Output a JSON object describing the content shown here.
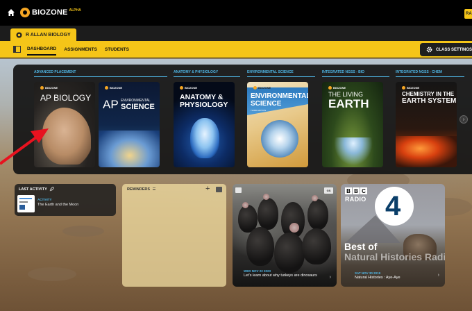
{
  "topbar": {
    "logo_text": "BIOZONE",
    "logo_badge": "ALPHA",
    "user_initials": "RA"
  },
  "class_tab": {
    "label": "R ALLAN BIOLOGY"
  },
  "nav": {
    "links": [
      "DASHBOARD",
      "ASSIGNMENTS",
      "STUDENTS"
    ],
    "active": "DASHBOARD",
    "settings_label": "CLASS SETTINGS"
  },
  "shelf": {
    "categories": [
      "ADVANCED PLACEMENT",
      "ANATOMY & PHYSIOLOGY",
      "ENVIRONMENTAL SCIENCE",
      "INTEGRATED NGSS - BIO",
      "INTEGRATED NGSS - CHEM"
    ],
    "books": [
      {
        "brand": "BIOZONE",
        "title": "AP BIOLOGY"
      },
      {
        "brand": "BIOZONE",
        "title_prefix": "AP",
        "title_small": "ENVIRONMENTAL",
        "title_big": "SCIENCE"
      },
      {
        "brand": "BIOZONE",
        "title_line1": "ANATOMY &",
        "title_line2": "PHYSIOLOGY"
      },
      {
        "brand": "BIOZONE",
        "title_line1": "ENVIRONMENTAL",
        "title_line2": "SCIENCE",
        "edition": "THIRD EDITION"
      },
      {
        "brand": "BIOZONE",
        "title_line1": "THE LIVING",
        "title_line2": "EARTH"
      },
      {
        "brand": "BIOZONE",
        "title_line1": "CHEMISTRY IN THE",
        "title_line2": "EARTH SYSTEM"
      }
    ],
    "next_icon": "chevron-right-icon"
  },
  "last_activity": {
    "title": "LAST ACTIVITY",
    "kind": "ACTIVITY",
    "name": "The Earth and the Moon"
  },
  "reminders": {
    "title": "REMINDERS"
  },
  "news_card": {
    "badge": "GS",
    "date": "WED NOV 22 2023",
    "text": "Let's learn about why turkeys are dinosaurs"
  },
  "radio_card": {
    "bbc": [
      "B",
      "B",
      "C"
    ],
    "radio_word": "RADIO",
    "station_number": "4",
    "headline_line1": "Best of",
    "headline_line2": "Natural Histories Radio",
    "date": "SAT NOV 30 2019",
    "text": "Natural Histories : Aye-Aye"
  },
  "colors": {
    "brand_yellow": "#f5c518",
    "accent_blue": "#4fb6e6",
    "annotation_red": "#e8121f"
  }
}
